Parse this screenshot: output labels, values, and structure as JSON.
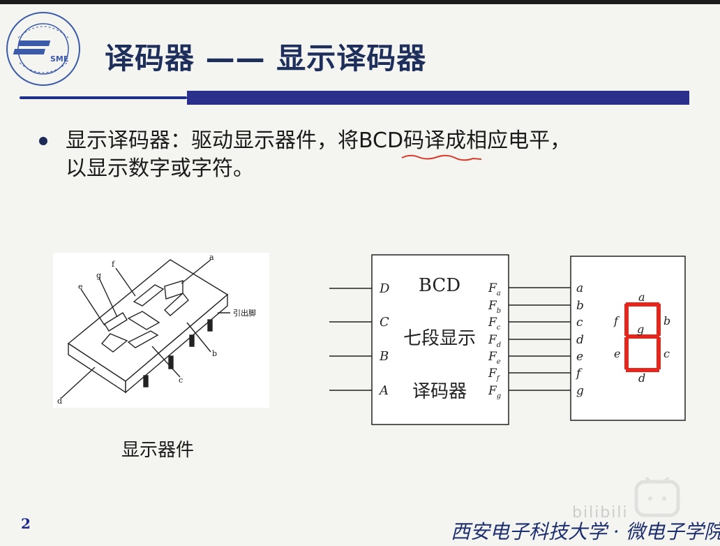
{
  "title": "译码器 —— 显示译码器",
  "body": {
    "line1": "显示译码器：驱动显示器件，将BCD码译成相应电平，",
    "line2": "以显示数字或字符。"
  },
  "device": {
    "caption": "显示器件",
    "labels": {
      "a": "a",
      "b": "b",
      "c": "c",
      "d": "d",
      "e": "e",
      "f": "f",
      "g": "g",
      "pins": "引出脚"
    }
  },
  "decoder": {
    "line1": "BCD",
    "line2": "七段显示",
    "line3": "译码器",
    "inputs": [
      "D",
      "C",
      "B",
      "A"
    ],
    "outputs": [
      "F",
      "F",
      "F",
      "F",
      "F",
      "F",
      "F"
    ],
    "output_subs": [
      "a",
      "b",
      "c",
      "d",
      "e",
      "f",
      "g"
    ]
  },
  "display": {
    "pins": [
      "a",
      "b",
      "c",
      "d",
      "e",
      "f",
      "g"
    ],
    "segment_labels": {
      "a": "a",
      "b": "b",
      "c": "c",
      "d": "d",
      "e": "e",
      "f": "f",
      "g": "g"
    },
    "segment_color": "#e8251a"
  },
  "page_number": "2",
  "footer": "西安电子科技大学 · 微电子学院",
  "watermark": "bilibili",
  "logo_text": "SME"
}
